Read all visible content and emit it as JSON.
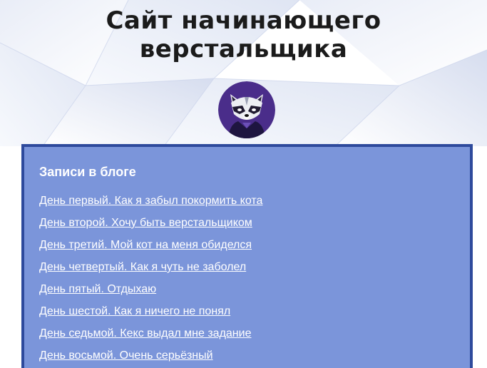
{
  "header": {
    "title_line1": "Сайт начинающего",
    "title_line2": "верстальщика"
  },
  "avatar": {
    "icon": "raccoon-avatar-icon",
    "bg_color": "#4a2d8a"
  },
  "blog": {
    "title": "Записи в блоге",
    "posts": [
      "День первый. Как я забыл покормить кота",
      "День второй. Хочу быть верстальщиком",
      "День третий. Мой кот на меня обиделся",
      "День четвертый. Как я чуть не заболел",
      "День пятый. Отдыхаю",
      "День шестой. Как я ничего не понял",
      "День седьмой. Кекс выдал мне задание",
      "День восьмой. Очень серьёзный"
    ]
  },
  "colors": {
    "panel_bg": "#7b95da",
    "panel_border": "#2e4a9c",
    "link": "#ffffff"
  }
}
